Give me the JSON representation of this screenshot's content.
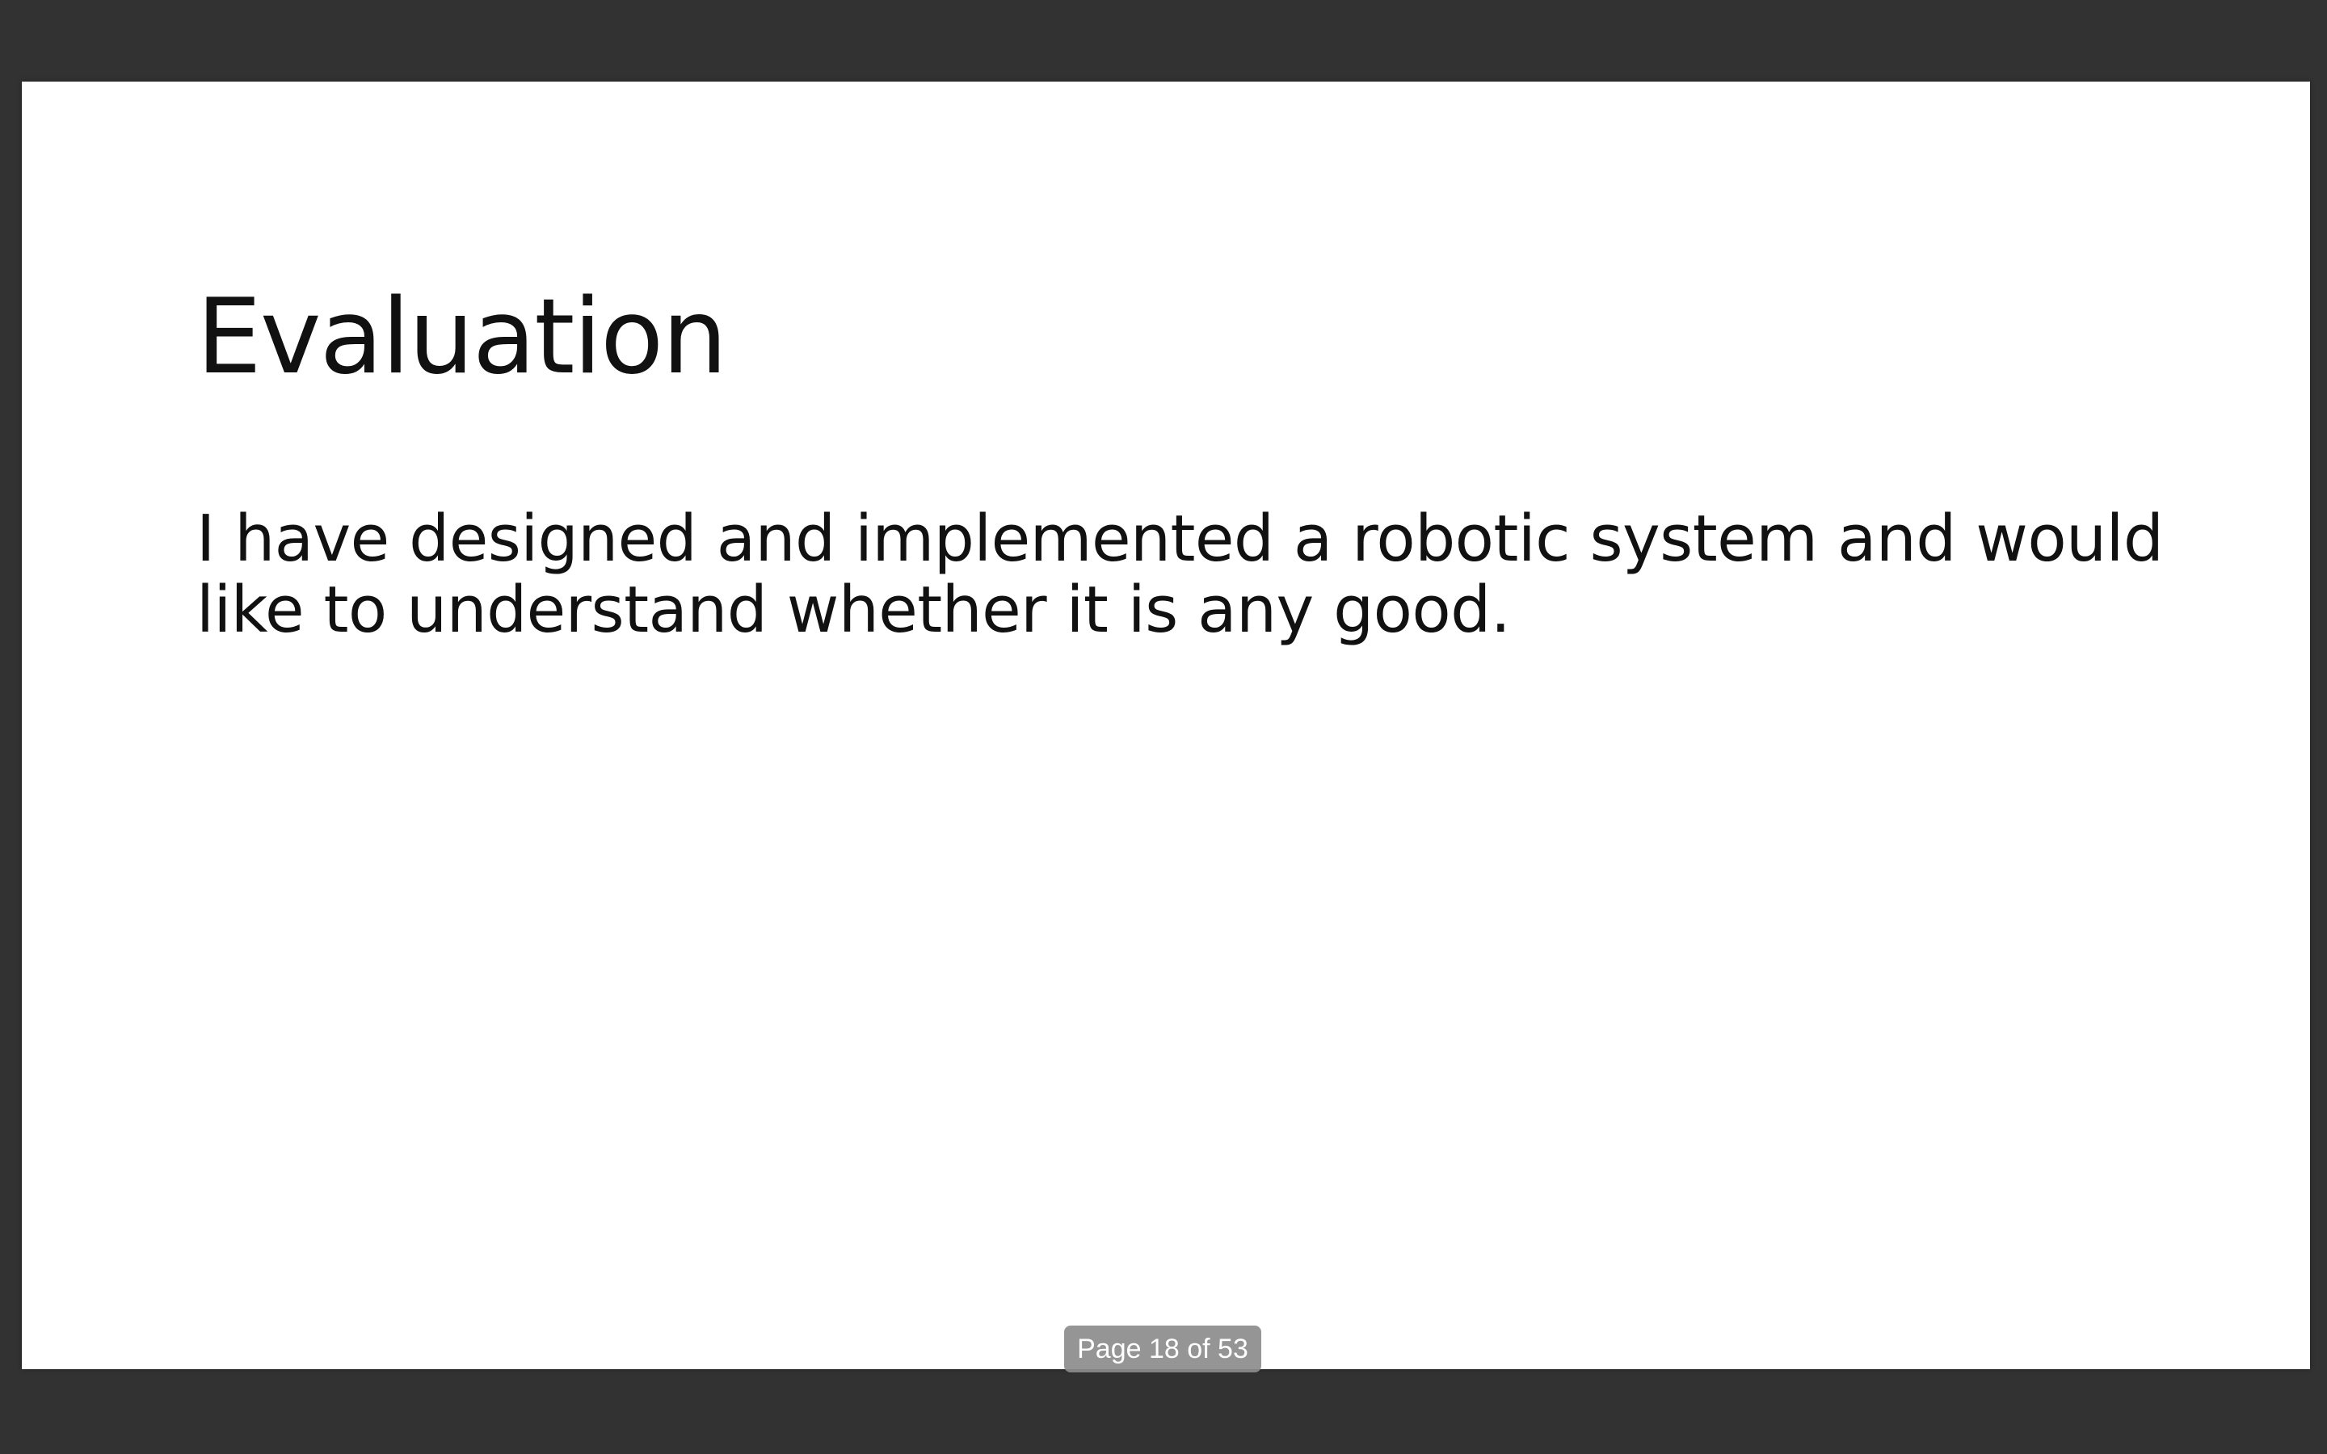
{
  "slide": {
    "title": "Evaluation",
    "body": "I have designed and implemented a robotic system and would like to understand whether it is any good."
  },
  "page_indicator": {
    "text": "Page 18 of 53",
    "current_page": 18,
    "total_pages": 53
  },
  "colors": {
    "viewer_background": "#323232",
    "slide_background": "#ffffff",
    "text": "#111111",
    "indicator_background": "#8c8c8c"
  }
}
